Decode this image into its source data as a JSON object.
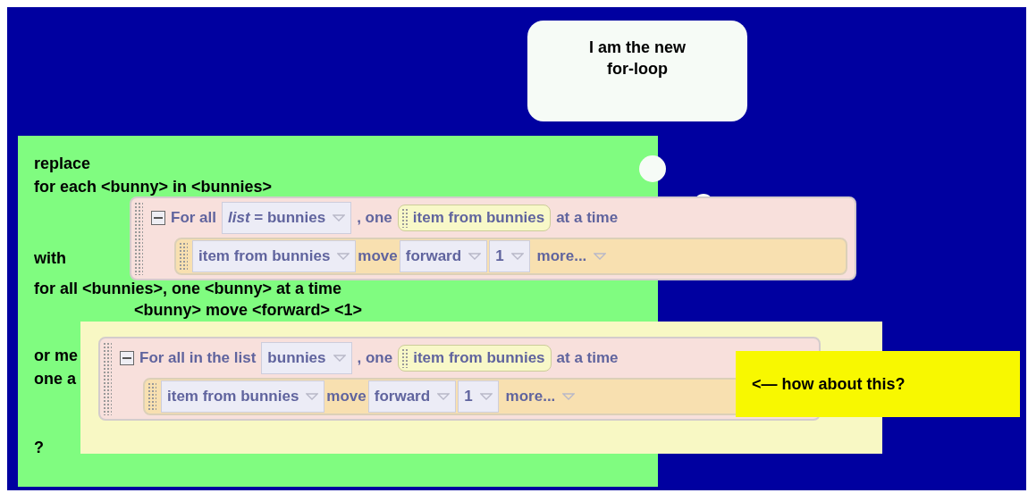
{
  "speech_bubble": {
    "lines": [
      "I am the new",
      "for-loop"
    ]
  },
  "note": {
    "lines": [
      "replace",
      "for each <bunny> in <bunnies>",
      "with",
      "for all <bunnies>, one <bunny> at a time",
      "<bunny> move <forward> <1>",
      "or me",
      "one a",
      "?"
    ]
  },
  "blocks": [
    {
      "header": [
        {
          "kind": "collapse"
        },
        {
          "kind": "label",
          "text": "For all"
        },
        {
          "kind": "dropdown",
          "text": "*list* = bunnies"
        },
        {
          "kind": "label",
          "text": ", one"
        },
        {
          "kind": "slot",
          "text": "item from bunnies"
        },
        {
          "kind": "label",
          "text": "at a time"
        }
      ],
      "body": [
        {
          "kind": "dropdown",
          "text": "item from bunnies"
        },
        {
          "kind": "label",
          "text": "move"
        },
        {
          "kind": "dropdown",
          "text": "forward"
        },
        {
          "kind": "dropdown",
          "text": "1"
        },
        {
          "kind": "menu",
          "text": "more..."
        }
      ]
    },
    {
      "header": [
        {
          "kind": "collapse"
        },
        {
          "kind": "label",
          "text": "For all in the list"
        },
        {
          "kind": "dropdown",
          "text": "bunnies"
        },
        {
          "kind": "label",
          "text": ", one"
        },
        {
          "kind": "slot",
          "text": "item from bunnies"
        },
        {
          "kind": "label",
          "text": "at a time"
        }
      ],
      "body": [
        {
          "kind": "dropdown",
          "text": "item from bunnies"
        },
        {
          "kind": "label",
          "text": "move"
        },
        {
          "kind": "dropdown",
          "text": "forward"
        },
        {
          "kind": "dropdown",
          "text": "1"
        },
        {
          "kind": "menu",
          "text": "more..."
        }
      ]
    }
  ],
  "callout": {
    "text": "<— how about this?"
  }
}
